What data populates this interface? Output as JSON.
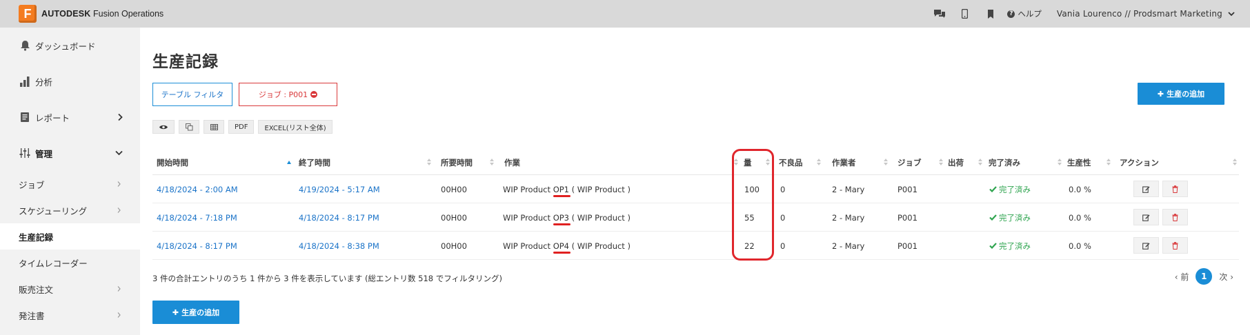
{
  "brand": {
    "logo_letter": "F",
    "company": "AUTODESK",
    "product": "Fusion Operations"
  },
  "topbar": {
    "icons": [
      "chat-icon",
      "mobile-icon",
      "bookmark-icon"
    ],
    "help_label": "ヘルプ",
    "user_label": "Vania Lourenco // Prodsmart Marketing"
  },
  "sidebar": {
    "main_items": [
      {
        "label": "ダッシュボード",
        "icon": "bell-icon"
      },
      {
        "label": "分析",
        "icon": "bar-chart-icon"
      },
      {
        "label": "レポート",
        "icon": "document-icon"
      },
      {
        "label": "管理",
        "icon": "sliders-icon"
      }
    ],
    "sub_items": [
      {
        "label": "ジョブ"
      },
      {
        "label": "スケジューリング"
      },
      {
        "label": "生産記録"
      },
      {
        "label": "タイムレコーダー"
      },
      {
        "label": "販売注文"
      },
      {
        "label": "発注書"
      }
    ]
  },
  "page": {
    "title": "生産記録",
    "filter_button": "テーブル フィルタ",
    "job_filter_button": "ジョブ : P001",
    "add_button": "生産の追加",
    "tools": [
      "PDF",
      "EXCEL(リスト全体)"
    ]
  },
  "table": {
    "headers": [
      "開始時間",
      "終了時間",
      "所要時間",
      "作業",
      "量",
      "不良品",
      "作業者",
      "ジョブ",
      "出荷",
      "完了済み",
      "生産性",
      "アクション"
    ],
    "rows": [
      {
        "start": "4/18/2024 - 2:00 AM",
        "end": "4/19/2024 - 5:17 AM",
        "duration": "00H00",
        "product": "WIP Product",
        "op": "OP1",
        "product_suffix": "( WIP Product )",
        "qty": "100",
        "defects": "0",
        "worker": "2 - Mary",
        "job": "P001",
        "shipment": "",
        "status": "完了済み",
        "productivity": "0.0 %"
      },
      {
        "start": "4/18/2024 - 7:18 PM",
        "end": "4/18/2024 - 8:17 PM",
        "duration": "00H00",
        "product": "WIP Product",
        "op": "OP3",
        "product_suffix": "( WIP Product )",
        "qty": "55",
        "defects": "0",
        "worker": "2 - Mary",
        "job": "P001",
        "shipment": "",
        "status": "完了済み",
        "productivity": "0.0 %"
      },
      {
        "start": "4/18/2024 - 8:17 PM",
        "end": "4/18/2024 - 8:38 PM",
        "duration": "00H00",
        "product": "WIP Product",
        "op": "OP4",
        "product_suffix": "( WIP Product )",
        "qty": "22",
        "defects": "0",
        "worker": "2 - Mary",
        "job": "P001",
        "shipment": "",
        "status": "完了済み",
        "productivity": "0.0 %"
      }
    ]
  },
  "footer": {
    "summary": "3 件の合計エントリのうち 1 件から 3 件を表示しています (総エントリ数 518 でフィルタリング)",
    "prev": "前",
    "page": "1",
    "next": "次"
  },
  "colors": {
    "accent": "#1a8dd6",
    "danger": "#d9383a",
    "success": "#2ea44f",
    "highlight": "#e0262c"
  }
}
